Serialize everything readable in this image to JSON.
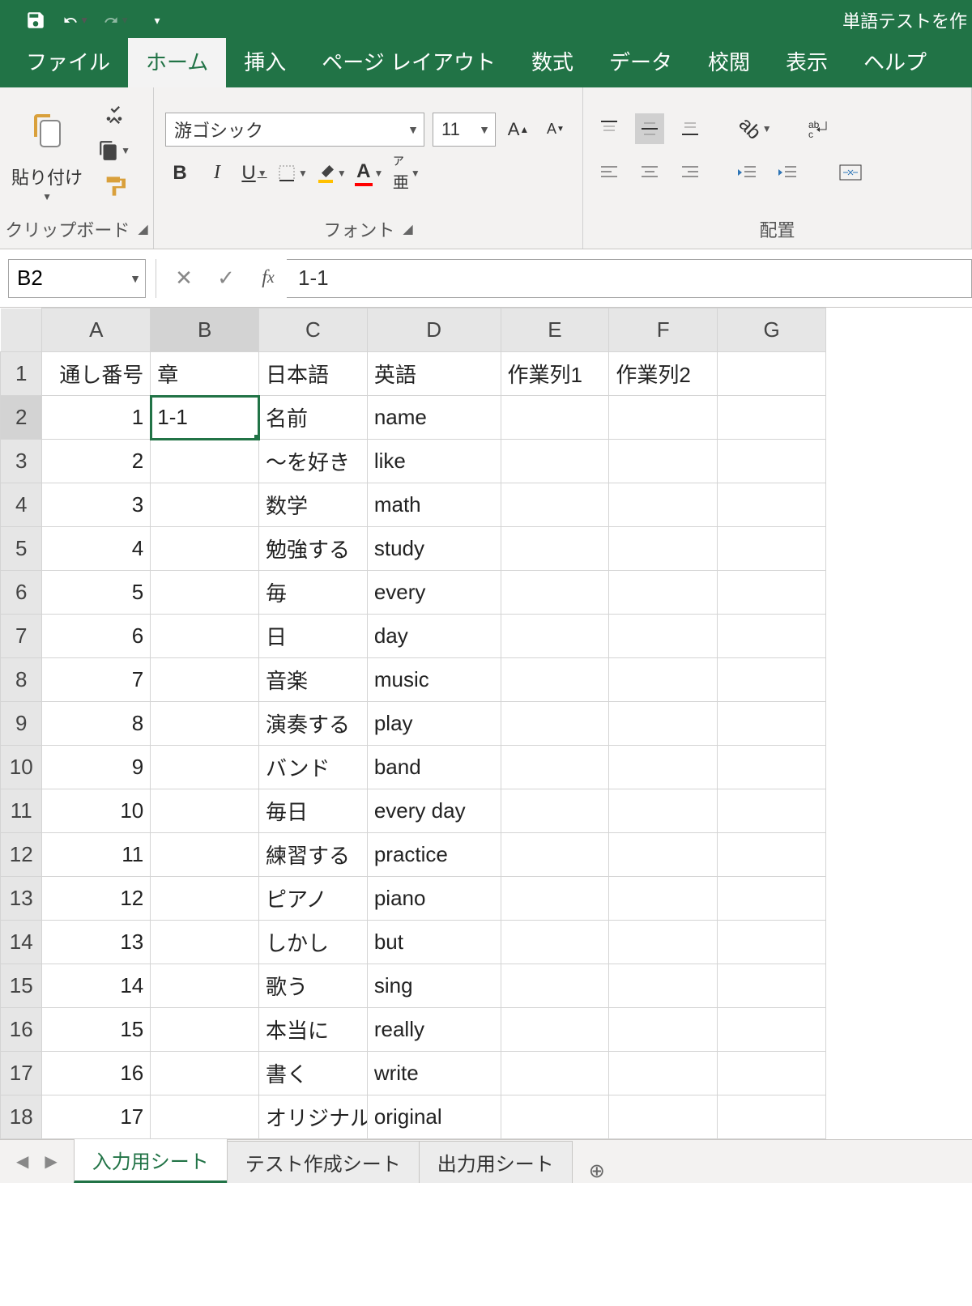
{
  "titlebar": {
    "doc_title": "単語テストを作"
  },
  "tabs": {
    "file": "ファイル",
    "home": "ホーム",
    "insert": "挿入",
    "layout": "ページ レイアウト",
    "formulas": "数式",
    "data": "データ",
    "review": "校閲",
    "view": "表示",
    "help": "ヘルプ"
  },
  "ribbon": {
    "clipboard_label": "クリップボード",
    "paste_label": "貼り付け",
    "font_label": "フォント",
    "font_name": "游ゴシック",
    "font_size": "11",
    "align_label": "配置"
  },
  "namebox": "B2",
  "formula": "1-1",
  "columns": [
    "A",
    "B",
    "C",
    "D",
    "E",
    "F",
    "G"
  ],
  "headers": [
    "通し番号",
    "章",
    "日本語",
    "英語",
    "作業列1",
    "作業列2",
    ""
  ],
  "rows": [
    {
      "n": 1,
      "a": "1",
      "b": "1-1",
      "c": "名前",
      "d": "name"
    },
    {
      "n": 2,
      "a": "2",
      "b": "",
      "c": "～を好き",
      "d": "like"
    },
    {
      "n": 3,
      "a": "3",
      "b": "",
      "c": "数学",
      "d": "math"
    },
    {
      "n": 4,
      "a": "4",
      "b": "",
      "c": "勉強する",
      "d": "study"
    },
    {
      "n": 5,
      "a": "5",
      "b": "",
      "c": "毎",
      "d": "every"
    },
    {
      "n": 6,
      "a": "6",
      "b": "",
      "c": "日",
      "d": "day"
    },
    {
      "n": 7,
      "a": "7",
      "b": "",
      "c": "音楽",
      "d": "music"
    },
    {
      "n": 8,
      "a": "8",
      "b": "",
      "c": "演奏する",
      "d": "play"
    },
    {
      "n": 9,
      "a": "9",
      "b": "",
      "c": "バンド",
      "d": "band"
    },
    {
      "n": 10,
      "a": "10",
      "b": "",
      "c": "毎日",
      "d": "every day"
    },
    {
      "n": 11,
      "a": "11",
      "b": "",
      "c": "練習する",
      "d": "practice"
    },
    {
      "n": 12,
      "a": "12",
      "b": "",
      "c": "ピアノ",
      "d": "piano"
    },
    {
      "n": 13,
      "a": "13",
      "b": "",
      "c": "しかし",
      "d": "but"
    },
    {
      "n": 14,
      "a": "14",
      "b": "",
      "c": "歌う",
      "d": "sing"
    },
    {
      "n": 15,
      "a": "15",
      "b": "",
      "c": "本当に",
      "d": "really"
    },
    {
      "n": 16,
      "a": "16",
      "b": "",
      "c": "書く",
      "d": "write"
    },
    {
      "n": 17,
      "a": "17",
      "b": "",
      "c": "オリジナル",
      "d": "original"
    }
  ],
  "sheets": {
    "s1": "入力用シート",
    "s2": "テスト作成シート",
    "s3": "出力用シート"
  },
  "selected_cell": {
    "row": 2,
    "col": "B"
  }
}
